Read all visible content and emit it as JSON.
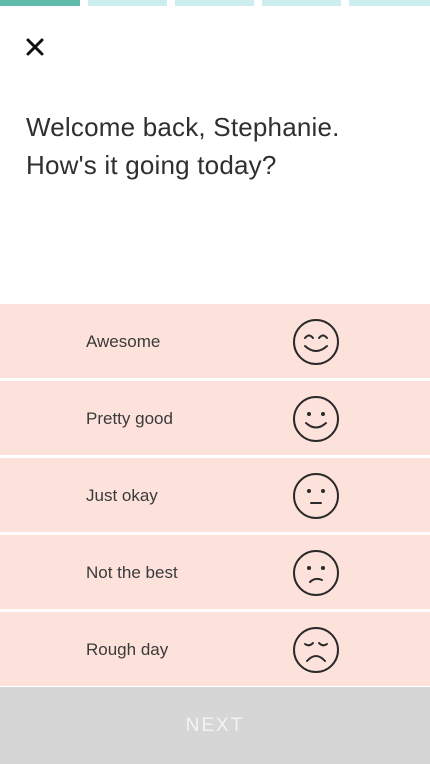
{
  "theme": {
    "accent": "#5ebaa9",
    "progress_inactive": "#cdeeee",
    "option_bg": "#fde2dc",
    "face_stroke": "#2a2a2a",
    "next_bg": "#d6d6d6"
  },
  "progress": {
    "total_steps": 5,
    "current_step": 1
  },
  "header": {
    "close_icon": "close-icon"
  },
  "greeting": {
    "line1": "Welcome back, Stephanie.",
    "line2": "How's it going today?"
  },
  "moods": [
    {
      "label": "Awesome",
      "icon": "very-happy-face-icon"
    },
    {
      "label": "Pretty good",
      "icon": "smiling-face-icon"
    },
    {
      "label": "Just okay",
      "icon": "neutral-face-icon"
    },
    {
      "label": "Not the best",
      "icon": "slightly-sad-face-icon"
    },
    {
      "label": "Rough day",
      "icon": "frowning-face-icon"
    }
  ],
  "footer": {
    "next_label": "NEXT"
  }
}
